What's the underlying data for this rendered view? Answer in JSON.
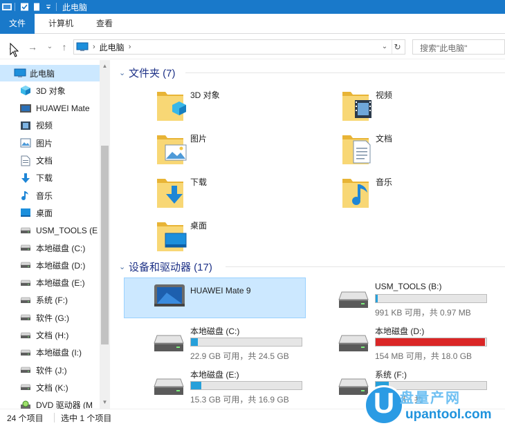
{
  "window": {
    "title": "此电脑"
  },
  "ribbon": {
    "tabs": [
      "文件",
      "计算机",
      "查看"
    ]
  },
  "address": {
    "crumb": "此电脑",
    "search_placeholder": "搜索\"此电脑\""
  },
  "sidebar": {
    "items": [
      {
        "label": "此电脑",
        "icon": "computer-icon",
        "selected": true
      },
      {
        "label": "3D 对象",
        "icon": "3d-objects-icon"
      },
      {
        "label": "HUAWEI Mate",
        "icon": "phone-icon"
      },
      {
        "label": "视频",
        "icon": "videos-icon"
      },
      {
        "label": "图片",
        "icon": "pictures-icon"
      },
      {
        "label": "文档",
        "icon": "documents-icon"
      },
      {
        "label": "下载",
        "icon": "downloads-icon"
      },
      {
        "label": "音乐",
        "icon": "music-icon"
      },
      {
        "label": "桌面",
        "icon": "desktop-icon"
      },
      {
        "label": "USM_TOOLS (E",
        "icon": "drive-icon"
      },
      {
        "label": "本地磁盘 (C:)",
        "icon": "drive-icon"
      },
      {
        "label": "本地磁盘 (D:)",
        "icon": "drive-icon"
      },
      {
        "label": "本地磁盘 (E:)",
        "icon": "drive-icon"
      },
      {
        "label": "系统 (F:)",
        "icon": "drive-icon"
      },
      {
        "label": "软件 (G:)",
        "icon": "drive-icon"
      },
      {
        "label": "文档 (H:)",
        "icon": "drive-icon"
      },
      {
        "label": "本地磁盘 (I:)",
        "icon": "drive-icon"
      },
      {
        "label": "软件 (J:)",
        "icon": "drive-icon"
      },
      {
        "label": "文档 (K:)",
        "icon": "drive-icon"
      },
      {
        "label": "DVD 驱动器 (M",
        "icon": "dvd-drive-icon"
      }
    ]
  },
  "folders_group": {
    "title": "文件夹 (7)",
    "items": [
      {
        "label": "3D 对象",
        "icon": "3d-objects-folder-icon"
      },
      {
        "label": "视频",
        "icon": "videos-folder-icon"
      },
      {
        "label": "图片",
        "icon": "pictures-folder-icon"
      },
      {
        "label": "文档",
        "icon": "documents-folder-icon"
      },
      {
        "label": "下载",
        "icon": "downloads-folder-icon"
      },
      {
        "label": "音乐",
        "icon": "music-folder-icon"
      },
      {
        "label": "桌面",
        "icon": "desktop-folder-icon"
      }
    ]
  },
  "devices_group": {
    "title": "设备和驱动器 (17)",
    "items": [
      {
        "label": "HUAWEI Mate 9",
        "type": "device",
        "selected": true
      },
      {
        "label": "USM_TOOLS (B:)",
        "type": "drive",
        "free_text": "991 KB 可用，共 0.97 MB",
        "used_fraction": 0.005,
        "bar_color": "#26a0da"
      },
      {
        "label": "本地磁盘 (C:)",
        "type": "drive",
        "free_text": "22.9 GB 可用，共 24.5 GB",
        "used_fraction": 0.065,
        "bar_color": "#26a0da"
      },
      {
        "label": "本地磁盘 (D:)",
        "type": "drive",
        "free_text": "154 MB 可用，共 18.0 GB",
        "used_fraction": 0.99,
        "bar_color": "#da2626"
      },
      {
        "label": "本地磁盘 (E:)",
        "type": "drive",
        "free_text": "15.3 GB 可用，共 16.9 GB",
        "used_fraction": 0.095,
        "bar_color": "#26a0da"
      },
      {
        "label": "系统 (F:)",
        "type": "drive",
        "free_text": "GB 可用，共 ",
        "used_fraction": 0.12,
        "bar_color": "#26a0da"
      }
    ]
  },
  "status": {
    "count": "24 个项目",
    "selected": "选中 1 个项目"
  },
  "watermark": {
    "letter": "U",
    "site_cn": "盘量产网",
    "url": "upantool.com"
  }
}
